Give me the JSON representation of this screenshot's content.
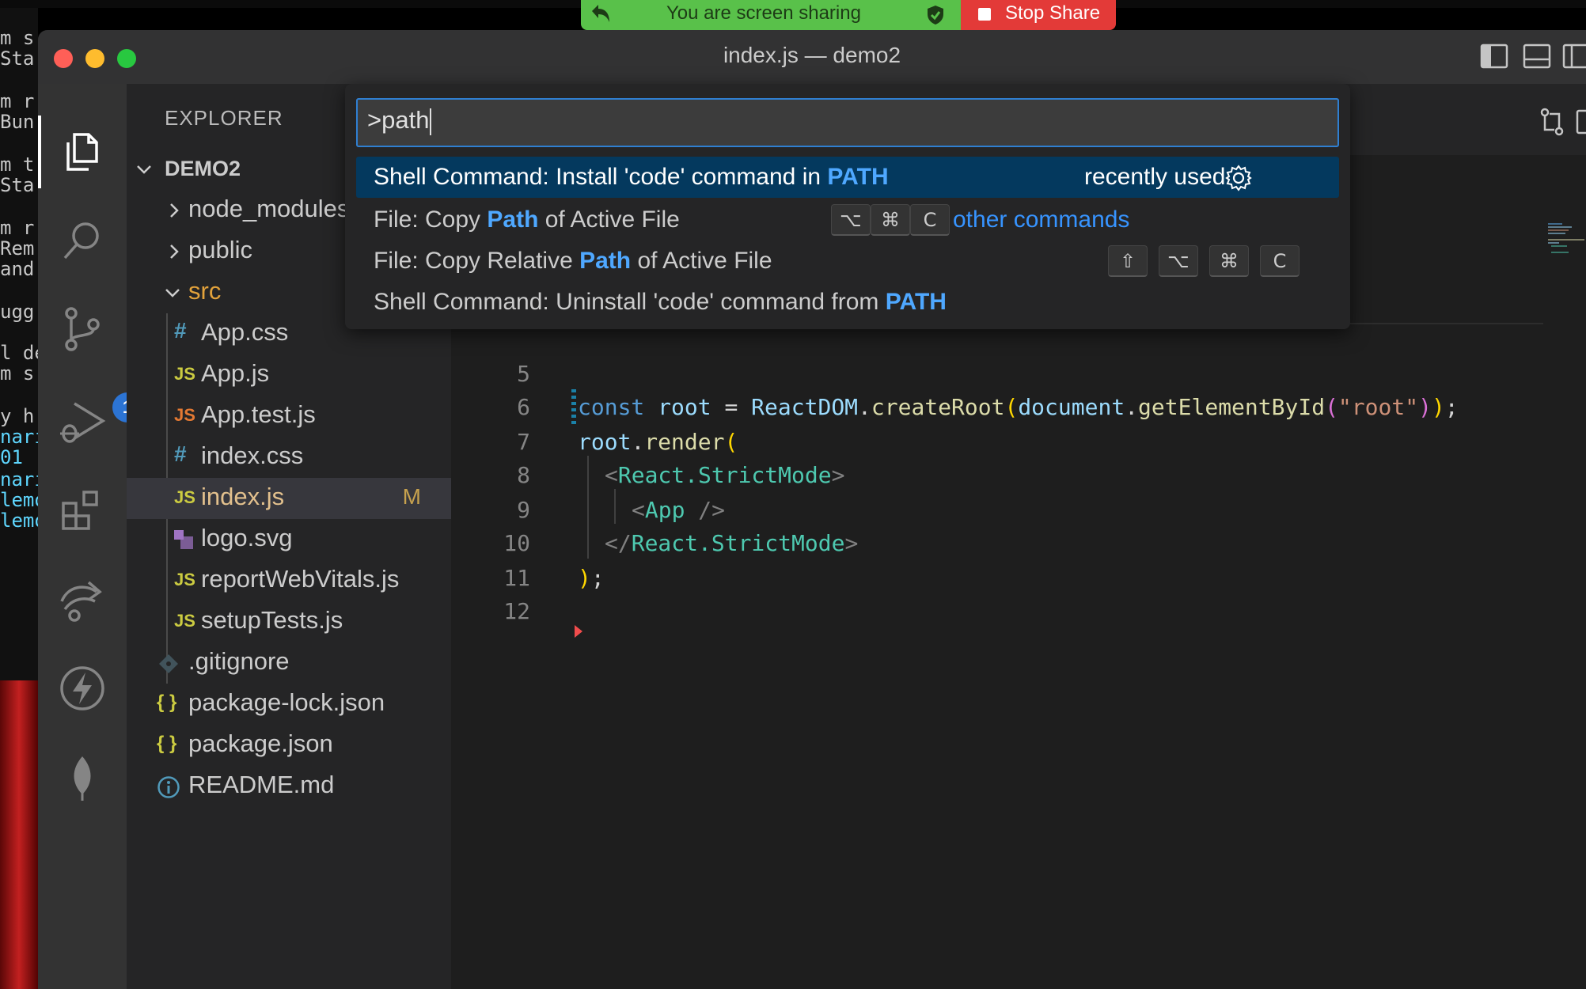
{
  "share_banner": {
    "message": "You are screen sharing",
    "stop_label": "Stop Share"
  },
  "window": {
    "title": "index.js — demo2"
  },
  "background_terminal": {
    "lines": [
      "m s",
      "Sta",
      "m r",
      "Bun",
      "m t",
      "Sta",
      "m r",
      "Rem",
      "and",
      "ugg",
      "l de",
      "m s",
      "y h",
      "nari",
      "01",
      "nari",
      "lemo",
      "lemo"
    ]
  },
  "activity_bar": {
    "source_control_badge": "1"
  },
  "sidebar": {
    "title": "EXPLORER",
    "root_folder": "DEMO2",
    "items": [
      {
        "name": "node_modules",
        "type": "folder",
        "icon": "chevron-right-icon"
      },
      {
        "name": "public",
        "type": "folder",
        "icon": "chevron-right-icon"
      },
      {
        "name": "src",
        "type": "folder-open",
        "icon": "chevron-down-icon"
      },
      {
        "name": "App.css",
        "type": "css",
        "icon_text": "#"
      },
      {
        "name": "App.js",
        "type": "js",
        "icon_text": "JS"
      },
      {
        "name": "App.test.js",
        "type": "js-test",
        "icon_text": "JS"
      },
      {
        "name": "index.css",
        "type": "css",
        "icon_text": "#"
      },
      {
        "name": "index.js",
        "type": "js",
        "icon_text": "JS",
        "git_status": "M",
        "selected": true
      },
      {
        "name": "logo.svg",
        "type": "svg",
        "icon": "image-icon"
      },
      {
        "name": "reportWebVitals.js",
        "type": "js",
        "icon_text": "JS"
      },
      {
        "name": "setupTests.js",
        "type": "js",
        "icon_text": "JS"
      },
      {
        "name": ".gitignore",
        "type": "git",
        "icon": "git-diamond-icon"
      },
      {
        "name": "package-lock.json",
        "type": "json",
        "icon_text": "{ }"
      },
      {
        "name": "package.json",
        "type": "json",
        "icon_text": "{ }"
      },
      {
        "name": "README.md",
        "type": "info",
        "icon": "info-icon"
      }
    ]
  },
  "command_palette": {
    "input_value": ">path",
    "items": [
      {
        "prefix": "Shell Command: Install 'code' command in ",
        "match": "PATH",
        "suffix": "",
        "note": "recently used",
        "active": true
      },
      {
        "prefix": "File: Copy ",
        "match": "Path",
        "suffix": " of Active File",
        "keys": [
          "⌥",
          "⌘",
          "C"
        ],
        "note": "other commands"
      },
      {
        "prefix": "File: Copy Relative ",
        "match": "Path",
        "suffix": " of Active File",
        "keys": [
          "⇧",
          "⌥",
          "⌘",
          "C"
        ]
      },
      {
        "prefix": "Shell Command: Uninstall 'code' command from ",
        "match": "PATH",
        "suffix": ""
      }
    ]
  },
  "editor": {
    "line_numbers": [
      "5",
      "6",
      "7",
      "8",
      "9",
      "10",
      "11",
      "12"
    ],
    "code": {
      "l6_const": "const",
      "l6_root": "root",
      "l6_eq": " = ",
      "l6_reactdom": "ReactDOM",
      "l6_dot1": ".",
      "l6_create": "createRoot",
      "l6_p1": "(",
      "l6_document": "document",
      "l6_dot2": ".",
      "l6_getel": "getElementById",
      "l6_p2": "(",
      "l6_str": "\"root\"",
      "l6_p3": ")",
      "l6_p4": ")",
      "l6_semi": ";",
      "l7_root": "root",
      "l7_dot": ".",
      "l7_render": "render",
      "l7_p": "(",
      "l8_open": "<",
      "l8_tag": "React.StrictMode",
      "l8_close": ">",
      "l9_open": "<",
      "l9_tag": "App",
      "l9_close": " />",
      "l10_open": "</",
      "l10_tag": "React.StrictMode",
      "l10_close": ">",
      "l11_p": ")",
      "l11_semi": ";"
    }
  },
  "colors": {
    "accent": "#2f7fd1",
    "highlight": "#4fa8ff",
    "share_green": "#59c14a",
    "share_red": "#e33a38",
    "badge": "#2c74d4"
  }
}
